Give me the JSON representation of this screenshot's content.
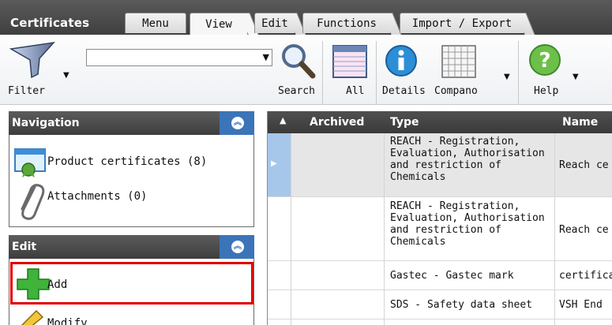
{
  "app": {
    "title": "Certificates"
  },
  "tabs": [
    {
      "label": "Menu"
    },
    {
      "label": "View"
    },
    {
      "label": "Edit"
    },
    {
      "label": "Functions"
    },
    {
      "label": "Import / Export"
    }
  ],
  "toolbar": {
    "filter_label": "Filter",
    "search_value": "",
    "search_label": "Search",
    "all_label": "All",
    "details_label": "Details",
    "compano_label": "Compano",
    "help_label": "Help"
  },
  "navigation": {
    "title": "Navigation",
    "items": [
      {
        "label": "Product certificates (8)",
        "icon": "certificate-icon"
      },
      {
        "label": "Attachments (0)",
        "icon": "paperclip-icon"
      }
    ]
  },
  "edit_panel": {
    "title": "Edit",
    "items": [
      {
        "label": "Add",
        "icon": "add-icon"
      },
      {
        "label": "Modify",
        "icon": "pencil-icon"
      }
    ]
  },
  "grid": {
    "columns": [
      "Archived",
      "Type",
      "Name"
    ],
    "rows": [
      {
        "archived": "",
        "type": [
          "REACH - Registration,",
          "Evaluation, Authorisation",
          "and restriction of",
          "Chemicals"
        ],
        "name": "Reach ce"
      },
      {
        "archived": "",
        "type": [
          "REACH - Registration,",
          "Evaluation, Authorisation",
          "and restriction of",
          "Chemicals"
        ],
        "name": "Reach ce"
      },
      {
        "archived": "",
        "type": [
          "Gastec - Gastec mark"
        ],
        "name": "certificat"
      },
      {
        "archived": "",
        "type": [
          "SDS - Safety data sheet"
        ],
        "name": "VSH End"
      }
    ]
  },
  "colors": {
    "header_dark": "#444444",
    "collapse_blue": "#3b74b8",
    "highlight_red": "#e00000",
    "selected_row": "#e6e6e6"
  }
}
